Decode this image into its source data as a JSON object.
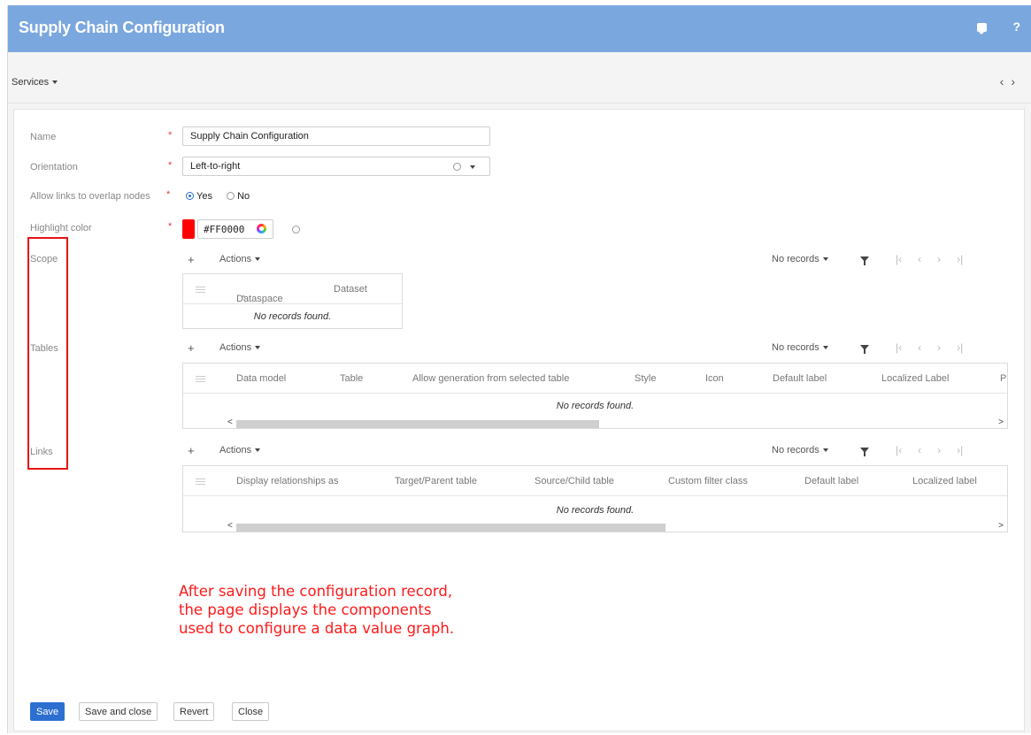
{
  "window": {
    "title": "Supply Chain Configuration",
    "help_label": "?"
  },
  "toolbar": {
    "services_label": "Services",
    "nav_prev": "‹",
    "nav_next": "›"
  },
  "form": {
    "name": {
      "label": "Name",
      "value": "Supply Chain Configuration",
      "required": "*"
    },
    "orientation": {
      "label": "Orientation",
      "value": "Left-to-right",
      "required": "*"
    },
    "overlap": {
      "label": "Allow links to overlap nodes",
      "required": "*",
      "option_yes": "Yes",
      "option_no": "No",
      "selected": "Yes"
    },
    "highlight": {
      "label": "Highlight color",
      "value": "#FF0000",
      "required": "*",
      "swatch_color": "#FF0000"
    }
  },
  "sections": {
    "scope": {
      "label": "Scope",
      "actions_label": "Actions",
      "records_label": "No records",
      "columns": [
        "Dataspace",
        "Dataset"
      ],
      "empty_text": "No records found."
    },
    "tables": {
      "label": "Tables",
      "actions_label": "Actions",
      "records_label": "No records",
      "columns": [
        "Data model",
        "Table",
        "Allow generation from selected table",
        "Style",
        "Icon",
        "Default label",
        "Localized Label",
        "P"
      ],
      "empty_text": "No records found."
    },
    "links": {
      "label": "Links",
      "actions_label": "Actions",
      "records_label": "No records",
      "columns": [
        "Display relationships as",
        "Target/Parent table",
        "Source/Child table",
        "Custom filter class",
        "Default label",
        "Localized label"
      ],
      "empty_text": "No records found."
    }
  },
  "annotation": {
    "lines": [
      "After saving the configuration record,",
      "the page displays the components",
      "used to configure a data value graph."
    ],
    "color": "#FF1A1A"
  },
  "buttons": {
    "save": "Save",
    "save_close": "Save and close",
    "revert": "Revert",
    "close": "Close"
  },
  "colors": {
    "titlebar": "#7BA7DF",
    "primary_button": "#2D6FD1",
    "highlight_box": "#E51515"
  }
}
